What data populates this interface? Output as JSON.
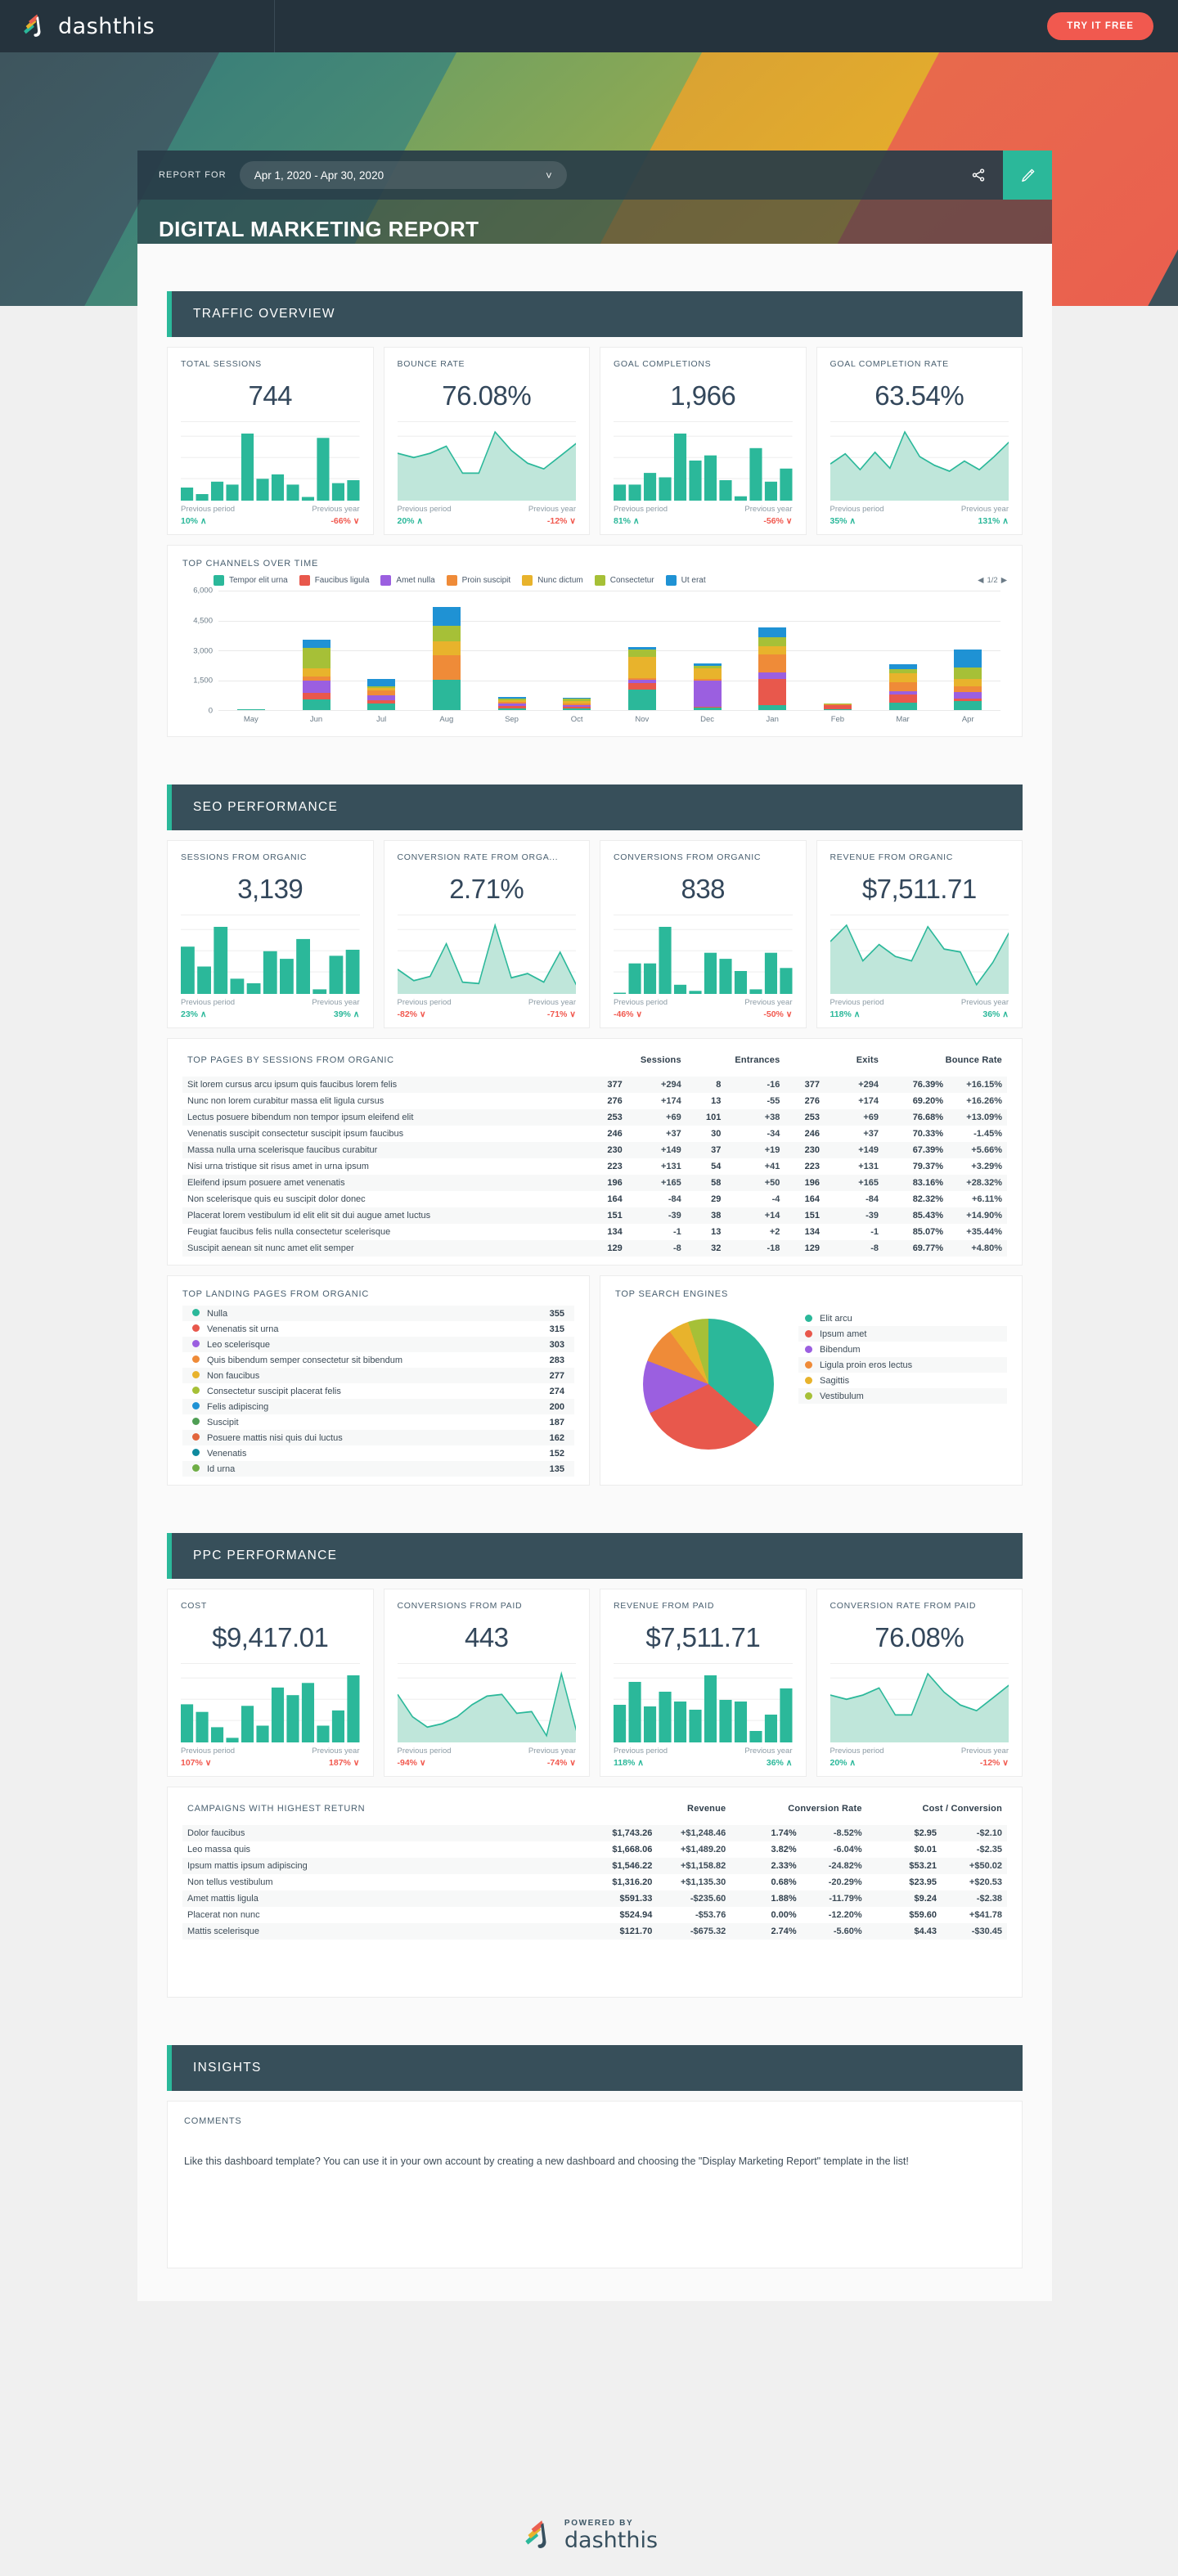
{
  "topnav": {
    "brand": "dashthis",
    "try_free_label": "TRY IT FREE",
    "brand_icon": "dashthis-logo-icon"
  },
  "banner": {
    "report_for_label": "REPORT FOR",
    "date_range": "Apr 1, 2020 - Apr 30, 2020",
    "chevron": "˅",
    "share_icon": "share-icon",
    "edit_icon": "pencil-icon",
    "report_title": "DIGITAL MARKETING REPORT",
    "stripe_colors": [
      "#3d5059",
      "#3a7f79",
      "#7ba35e",
      "#e0a42c",
      "#ea5f4f"
    ]
  },
  "accent": {
    "teal": "#2bb89a",
    "dark": "#374f5a",
    "red": "#f1594f"
  },
  "sections": {
    "traffic": {
      "title": "TRAFFIC OVERVIEW"
    },
    "seo": {
      "title": "SEO PERFORMANCE"
    },
    "ppc": {
      "title": "PPC PERFORMANCE"
    },
    "insights": {
      "title": "INSIGHTS"
    }
  },
  "traffic_kpis": [
    {
      "title": "TOTAL SESSIONS",
      "value": "744",
      "prev_period_label": "Previous period",
      "prev_year_label": "Previous year",
      "prev_period_delta": "10%",
      "prev_period_dir": "up",
      "prev_year_delta": "-66%",
      "prev_year_dir": "down"
    },
    {
      "title": "BOUNCE RATE",
      "value": "76.08%",
      "prev_period_label": "Previous period",
      "prev_year_label": "Previous year",
      "prev_period_delta": "20%",
      "prev_period_dir": "up",
      "prev_year_delta": "-12%",
      "prev_year_dir": "down"
    },
    {
      "title": "GOAL COMPLETIONS",
      "value": "1,966",
      "prev_period_label": "Previous period",
      "prev_year_label": "Previous year",
      "prev_period_delta": "81%",
      "prev_period_dir": "up",
      "prev_year_delta": "-56%",
      "prev_year_dir": "down"
    },
    {
      "title": "GOAL COMPLETION RATE",
      "value": "63.54%",
      "prev_period_label": "Previous period",
      "prev_year_label": "Previous year",
      "prev_period_delta": "35%",
      "prev_period_dir": "up",
      "prev_year_delta": "131%",
      "prev_year_dir": "up"
    }
  ],
  "seo_kpis": [
    {
      "title": "SESSIONS FROM ORGANIC",
      "value": "3,139",
      "prev_period_label": "Previous period",
      "prev_year_label": "Previous year",
      "prev_period_delta": "23%",
      "prev_period_dir": "up",
      "prev_year_delta": "39%",
      "prev_year_dir": "up"
    },
    {
      "title": "CONVERSION RATE FROM ORGA...",
      "value": "2.71%",
      "prev_period_label": "Previous period",
      "prev_year_label": "Previous year",
      "prev_period_delta": "-82%",
      "prev_period_dir": "down",
      "prev_year_delta": "-71%",
      "prev_year_dir": "down"
    },
    {
      "title": "CONVERSIONS FROM ORGANIC",
      "value": "838",
      "prev_period_label": "Previous period",
      "prev_year_label": "Previous year",
      "prev_period_delta": "-46%",
      "prev_period_dir": "down",
      "prev_year_delta": "-50%",
      "prev_year_dir": "down"
    },
    {
      "title": "REVENUE FROM ORGANIC",
      "value": "$7,511.71",
      "prev_period_label": "Previous period",
      "prev_year_label": "Previous year",
      "prev_period_delta": "118%",
      "prev_period_dir": "up",
      "prev_year_delta": "36%",
      "prev_year_dir": "up"
    }
  ],
  "ppc_kpis": [
    {
      "title": "COST",
      "value": "$9,417.01",
      "prev_period_label": "Previous period",
      "prev_year_label": "Previous year",
      "prev_period_delta": "107%",
      "prev_period_dir": "down",
      "prev_year_delta": "187%",
      "prev_year_dir": "down"
    },
    {
      "title": "CONVERSIONS FROM PAID",
      "value": "443",
      "prev_period_label": "Previous period",
      "prev_year_label": "Previous year",
      "prev_period_delta": "-94%",
      "prev_period_dir": "down",
      "prev_year_delta": "-74%",
      "prev_year_dir": "down"
    },
    {
      "title": "REVENUE FROM PAID",
      "value": "$7,511.71",
      "prev_period_label": "Previous period",
      "prev_year_label": "Previous year",
      "prev_period_delta": "118%",
      "prev_period_dir": "up",
      "prev_year_delta": "36%",
      "prev_year_dir": "up"
    },
    {
      "title": "CONVERSION RATE FROM PAID",
      "value": "76.08%",
      "prev_period_label": "Previous period",
      "prev_year_label": "Previous year",
      "prev_period_delta": "20%",
      "prev_period_dir": "up",
      "prev_year_delta": "-12%",
      "prev_year_dir": "down"
    }
  ],
  "chart_data": [
    {
      "type": "bar",
      "name": "top-channels-over-time",
      "title": "TOP CHANNELS OVER TIME",
      "stacked": true,
      "xlabel": "",
      "ylabel": "",
      "ylim": [
        0,
        6000
      ],
      "yticks": [
        0,
        1500,
        3000,
        4500,
        6000
      ],
      "ytick_labels": [
        "0",
        "1,500",
        "3,000",
        "4,500",
        "6,000"
      ],
      "grid": true,
      "legend_position": "top",
      "pager": "1/2",
      "categories": [
        "May",
        "Jun",
        "Jul",
        "Aug",
        "Sep",
        "Oct",
        "Nov",
        "Dec",
        "Jan",
        "Feb",
        "Mar",
        "Apr"
      ],
      "series": [
        {
          "name": "Tempor elit urna",
          "color": "#2bb89a",
          "values": [
            40,
            520,
            310,
            1540,
            80,
            100,
            1010,
            110,
            250,
            30,
            380,
            450
          ]
        },
        {
          "name": "Faucibus ligula",
          "color": "#e8584c",
          "values": [
            0,
            330,
            170,
            0,
            110,
            60,
            350,
            60,
            1320,
            200,
            390,
            110
          ]
        },
        {
          "name": "Amet nulla",
          "color": "#9b5fe0",
          "values": [
            0,
            630,
            250,
            0,
            130,
            80,
            160,
            1300,
            340,
            20,
            180,
            360
          ]
        },
        {
          "name": "Proin suscipit",
          "color": "#ef8b38",
          "values": [
            0,
            190,
            240,
            1230,
            100,
            90,
            100,
            100,
            900,
            20,
            460,
            260
          ]
        },
        {
          "name": "Nunc dictum",
          "color": "#e8b32c",
          "values": [
            0,
            430,
            150,
            680,
            80,
            130,
            1040,
            520,
            390,
            20,
            460,
            390
          ]
        },
        {
          "name": "Consectetur",
          "color": "#a6c037",
          "values": [
            0,
            1010,
            60,
            790,
            60,
            110,
            400,
            130,
            450,
            20,
            190,
            580
          ]
        },
        {
          "name": "Ut erat",
          "color": "#1f92d4",
          "values": [
            0,
            420,
            370,
            950,
            80,
            60,
            120,
            110,
            510,
            20,
            230,
            910
          ]
        }
      ]
    },
    {
      "type": "pie",
      "name": "top-search-engines",
      "title": "TOP SEARCH ENGINES",
      "legend_position": "right",
      "labels": [
        "Elit arcu",
        "Ipsum amet",
        "Bibendum",
        "Ligula proin eros lectus",
        "Sagittis",
        "Vestibulum"
      ],
      "values": [
        36,
        31,
        13,
        9,
        5,
        5
      ],
      "colors": [
        "#2bb89a",
        "#e8584c",
        "#9b5fe0",
        "#ef8b38",
        "#e8b32c",
        "#a6c037"
      ]
    }
  ],
  "top_pages": {
    "title": "TOP PAGES BY SESSIONS FROM ORGANIC",
    "columns": [
      "Sessions",
      "Entrances",
      "Exits",
      "Bounce Rate"
    ],
    "rows": [
      {
        "name": "Sit lorem cursus arcu ipsum quis faucibus lorem felis",
        "sessions": "377",
        "sessions_d": "+294",
        "sessions_dir": "up",
        "entrances": "8",
        "entrances_d": "-16",
        "entrances_dir": "down",
        "exits": "377",
        "exits_d": "+294",
        "exits_dir": "up",
        "bounce": "76.39%",
        "bounce_d": "+16.15%",
        "bounce_dir": "up"
      },
      {
        "name": "Nunc non lorem curabitur massa elit ligula cursus",
        "sessions": "276",
        "sessions_d": "+174",
        "sessions_dir": "up",
        "entrances": "13",
        "entrances_d": "-55",
        "entrances_dir": "down",
        "exits": "276",
        "exits_d": "+174",
        "exits_dir": "up",
        "bounce": "69.20%",
        "bounce_d": "+16.26%",
        "bounce_dir": "up"
      },
      {
        "name": "Lectus posuere bibendum non tempor ipsum eleifend elit",
        "sessions": "253",
        "sessions_d": "+69",
        "sessions_dir": "up",
        "entrances": "101",
        "entrances_d": "+38",
        "entrances_dir": "up",
        "exits": "253",
        "exits_d": "+69",
        "exits_dir": "up",
        "bounce": "76.68%",
        "bounce_d": "+13.09%",
        "bounce_dir": "up"
      },
      {
        "name": "Venenatis suscipit consectetur suscipit ipsum faucibus",
        "sessions": "246",
        "sessions_d": "+37",
        "sessions_dir": "up",
        "entrances": "30",
        "entrances_d": "-34",
        "entrances_dir": "down",
        "exits": "246",
        "exits_d": "+37",
        "exits_dir": "up",
        "bounce": "70.33%",
        "bounce_d": "-1.45%",
        "bounce_dir": "down"
      },
      {
        "name": "Massa nulla urna scelerisque faucibus curabitur",
        "sessions": "230",
        "sessions_d": "+149",
        "sessions_dir": "up",
        "entrances": "37",
        "entrances_d": "+19",
        "entrances_dir": "up",
        "exits": "230",
        "exits_d": "+149",
        "exits_dir": "up",
        "bounce": "67.39%",
        "bounce_d": "+5.66%",
        "bounce_dir": "up"
      },
      {
        "name": "Nisi urna tristique sit risus amet in urna ipsum",
        "sessions": "223",
        "sessions_d": "+131",
        "sessions_dir": "up",
        "entrances": "54",
        "entrances_d": "+41",
        "entrances_dir": "up",
        "exits": "223",
        "exits_d": "+131",
        "exits_dir": "up",
        "bounce": "79.37%",
        "bounce_d": "+3.29%",
        "bounce_dir": "up"
      },
      {
        "name": "Eleifend ipsum posuere amet venenatis",
        "sessions": "196",
        "sessions_d": "+165",
        "sessions_dir": "up",
        "entrances": "58",
        "entrances_d": "+50",
        "entrances_dir": "up",
        "exits": "196",
        "exits_d": "+165",
        "exits_dir": "up",
        "bounce": "83.16%",
        "bounce_d": "+28.32%",
        "bounce_dir": "up"
      },
      {
        "name": "Non scelerisque quis eu suscipit dolor donec",
        "sessions": "164",
        "sessions_d": "-84",
        "sessions_dir": "down",
        "entrances": "29",
        "entrances_d": "-4",
        "entrances_dir": "down",
        "exits": "164",
        "exits_d": "-84",
        "exits_dir": "down",
        "bounce": "82.32%",
        "bounce_d": "+6.11%",
        "bounce_dir": "up"
      },
      {
        "name": "Placerat lorem vestibulum id elit elit sit dui augue amet luctus",
        "sessions": "151",
        "sessions_d": "-39",
        "sessions_dir": "down",
        "entrances": "38",
        "entrances_d": "+14",
        "entrances_dir": "up",
        "exits": "151",
        "exits_d": "-39",
        "exits_dir": "down",
        "bounce": "85.43%",
        "bounce_d": "+14.90%",
        "bounce_dir": "up"
      },
      {
        "name": "Feugiat faucibus felis nulla consectetur scelerisque",
        "sessions": "134",
        "sessions_d": "-1",
        "sessions_dir": "down",
        "entrances": "13",
        "entrances_d": "+2",
        "entrances_dir": "up",
        "exits": "134",
        "exits_d": "-1",
        "exits_dir": "down",
        "bounce": "85.07%",
        "bounce_d": "+35.44%",
        "bounce_dir": "up"
      },
      {
        "name": "Suscipit aenean sit nunc amet elit semper",
        "sessions": "129",
        "sessions_d": "-8",
        "sessions_dir": "down",
        "entrances": "32",
        "entrances_d": "-18",
        "entrances_dir": "down",
        "exits": "129",
        "exits_d": "-8",
        "exits_dir": "down",
        "bounce": "69.77%",
        "bounce_d": "+4.80%",
        "bounce_dir": "up"
      }
    ]
  },
  "top_landing_pages": {
    "title": "TOP LANDING PAGES FROM ORGANIC",
    "rows": [
      {
        "label": "Nulla",
        "value": "355",
        "color": "#2bb89a"
      },
      {
        "label": "Venenatis sit urna",
        "value": "315",
        "color": "#e8584c"
      },
      {
        "label": "Leo scelerisque",
        "value": "303",
        "color": "#9b5fe0"
      },
      {
        "label": "Quis bibendum semper consectetur sit bibendum",
        "value": "283",
        "color": "#ef8b38"
      },
      {
        "label": "Non faucibus",
        "value": "277",
        "color": "#e8b32c"
      },
      {
        "label": "Consectetur suscipit placerat felis",
        "value": "274",
        "color": "#a6c037"
      },
      {
        "label": "Felis adipiscing",
        "value": "200",
        "color": "#1f92d4"
      },
      {
        "label": "Suscipit",
        "value": "187",
        "color": "#4f9e54"
      },
      {
        "label": "Posuere mattis nisi quis dui luctus",
        "value": "162",
        "color": "#e2653c"
      },
      {
        "label": "Venenatis",
        "value": "152",
        "color": "#0f8a9e"
      },
      {
        "label": "Id urna",
        "value": "135",
        "color": "#6fae46"
      }
    ]
  },
  "campaigns": {
    "title": "CAMPAIGNS WITH HIGHEST RETURN",
    "columns": [
      "Revenue",
      "Conversion Rate",
      "Cost / Conversion"
    ],
    "rows": [
      {
        "name": "Dolor faucibus",
        "revenue": "$1,743.26",
        "revenue_d": "+$1,248.46",
        "revenue_dir": "up",
        "cvr": "1.74%",
        "cvr_d": "-8.52%",
        "cvr_dir": "down",
        "cpc": "$2.95",
        "cpc_d": "-$2.10",
        "cpc_dir": "up"
      },
      {
        "name": "Leo massa quis",
        "revenue": "$1,668.06",
        "revenue_d": "+$1,489.20",
        "revenue_dir": "up",
        "cvr": "3.82%",
        "cvr_d": "-6.04%",
        "cvr_dir": "down",
        "cpc": "$0.01",
        "cpc_d": "-$2.35",
        "cpc_dir": "up"
      },
      {
        "name": "Ipsum mattis ipsum adipiscing",
        "revenue": "$1,546.22",
        "revenue_d": "+$1,158.82",
        "revenue_dir": "up",
        "cvr": "2.33%",
        "cvr_d": "-24.82%",
        "cvr_dir": "down",
        "cpc": "$53.21",
        "cpc_d": "+$50.02",
        "cpc_dir": "down"
      },
      {
        "name": "Non tellus vestibulum",
        "revenue": "$1,316.20",
        "revenue_d": "+$1,135.30",
        "revenue_dir": "up",
        "cvr": "0.68%",
        "cvr_d": "-20.29%",
        "cvr_dir": "down",
        "cpc": "$23.95",
        "cpc_d": "+$20.53",
        "cpc_dir": "down"
      },
      {
        "name": "Amet mattis ligula",
        "revenue": "$591.33",
        "revenue_d": "-$235.60",
        "revenue_dir": "down",
        "cvr": "1.88%",
        "cvr_d": "-11.79%",
        "cvr_dir": "down",
        "cpc": "$9.24",
        "cpc_d": "-$2.38",
        "cpc_dir": "up"
      },
      {
        "name": "Placerat non nunc",
        "revenue": "$524.94",
        "revenue_d": "-$53.76",
        "revenue_dir": "down",
        "cvr": "0.00%",
        "cvr_d": "-12.20%",
        "cvr_dir": "down",
        "cpc": "$59.60",
        "cpc_d": "+$41.78",
        "cpc_dir": "down"
      },
      {
        "name": "Mattis scelerisque",
        "revenue": "$121.70",
        "revenue_d": "-$675.32",
        "revenue_dir": "down",
        "cvr": "2.74%",
        "cvr_d": "-5.60%",
        "cvr_dir": "down",
        "cpc": "$4.43",
        "cpc_d": "-$30.45",
        "cpc_dir": "up"
      }
    ]
  },
  "insights": {
    "comments_label": "COMMENTS",
    "comments_text": "Like this dashboard template? You can use it in your own account by creating a new dashboard and choosing the \"Display Marketing Report\" template in the list!"
  },
  "footer": {
    "powered_by": "POWERED BY",
    "brand": "dashthis"
  },
  "sparklines": {
    "total_sessions": {
      "kind": "bar",
      "values": [
        18,
        9,
        26,
        22,
        92,
        30,
        36,
        22,
        5,
        86,
        24,
        28
      ]
    },
    "bounce_rate": {
      "kind": "area",
      "values": [
        62,
        56,
        62,
        72,
        34,
        34,
        92,
        66,
        48,
        40,
        58,
        76
      ]
    },
    "goal_completions": {
      "kind": "bar",
      "values": [
        22,
        22,
        38,
        32,
        92,
        55,
        62,
        28,
        6,
        72,
        26,
        44
      ]
    },
    "goal_completion_rate": {
      "kind": "area",
      "values": [
        46,
        60,
        38,
        62,
        40,
        90,
        56,
        44,
        36,
        50,
        38,
        56,
        76
      ]
    },
    "sessions_organic": {
      "kind": "bar",
      "values": [
        62,
        36,
        88,
        20,
        14,
        56,
        46,
        72,
        6,
        50,
        58
      ]
    },
    "cvr_organic": {
      "kind": "area",
      "values": [
        30,
        14,
        20,
        66,
        12,
        10,
        92,
        18,
        24,
        12,
        54,
        8
      ]
    },
    "conversions_organic": {
      "kind": "bar",
      "values": [
        0,
        40,
        40,
        88,
        12,
        4,
        54,
        46,
        30,
        6,
        54,
        34
      ]
    },
    "revenue_organic": {
      "kind": "area",
      "values": [
        66,
        88,
        40,
        62,
        46,
        40,
        86,
        56,
        52,
        8,
        38,
        78
      ]
    },
    "cost": {
      "kind": "bar",
      "values": [
        50,
        40,
        20,
        6,
        48,
        22,
        72,
        62,
        78,
        22,
        42,
        88
      ]
    },
    "conversions_paid": {
      "kind": "area",
      "values": [
        52,
        26,
        14,
        18,
        26,
        40,
        50,
        52,
        30,
        32,
        4,
        76,
        10
      ]
    },
    "revenue_paid": {
      "kind": "bar",
      "values": [
        46,
        74,
        44,
        62,
        50,
        40,
        82,
        52,
        50,
        14,
        34,
        66
      ]
    },
    "cvr_paid": {
      "kind": "area",
      "values": [
        62,
        56,
        62,
        72,
        34,
        34,
        92,
        66,
        48,
        40,
        58,
        76
      ]
    }
  }
}
